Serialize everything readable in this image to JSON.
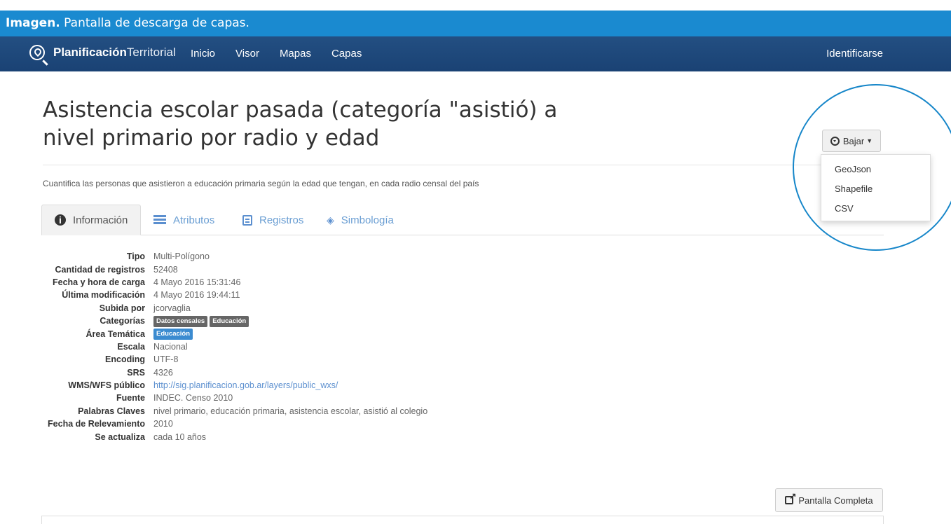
{
  "caption": {
    "bold": "Imagen.",
    "text": " Pantalla de descarga de capas."
  },
  "navbar": {
    "brand_bold": "Planificación",
    "brand_light": "Territorial",
    "links": [
      "Inicio",
      "Visor",
      "Mapas",
      "Capas"
    ],
    "login": "Identificarse"
  },
  "page": {
    "title": "Asistencia escolar pasada (categoría \"asistió) a nivel primario por radio y edad",
    "description": "Cuantifica las personas que asistieron a educación primaria según la edad que tengan, en cada radio censal del país"
  },
  "tabs": [
    "Información",
    "Atributos",
    "Registros",
    "Simbología"
  ],
  "info": {
    "tipo_label": "Tipo",
    "tipo": "Multi-Polígono",
    "registros_label": "Cantidad de registros",
    "registros": "52408",
    "carga_label": "Fecha y hora de carga",
    "carga": "4 Mayo 2016 15:31:46",
    "modificacion_label": "Última modificación",
    "modificacion": "4 Mayo 2016 19:44:11",
    "subida_label": "Subida por",
    "subida": "jcorvaglia",
    "categorias_label": "Categorías",
    "categorias": [
      "Datos censales",
      "Educación"
    ],
    "area_label": "Área Temática",
    "area": "Educación",
    "escala_label": "Escala",
    "escala": "Nacional",
    "encoding_label": "Encoding",
    "encoding": "UTF-8",
    "srs_label": "SRS",
    "srs": "4326",
    "wms_label": "WMS/WFS público",
    "wms": "http://sig.planificacion.gob.ar/layers/public_wxs/",
    "fuente_label": "Fuente",
    "fuente": "INDEC. Censo 2010",
    "claves_label": "Palabras Claves",
    "claves": "nivel primario, educación primaria, asistencia escolar, asistió al colegio",
    "relevamiento_label": "Fecha de Relevamiento",
    "relevamiento": "2010",
    "actualiza_label": "Se actualiza",
    "actualiza": "cada 10 años"
  },
  "download": {
    "label": "Bajar",
    "options": [
      "GeoJson",
      "Shapefile",
      "CSV"
    ]
  },
  "fullscreen_label": "Pantalla Completa",
  "colors": {
    "caption": "#1a8ad0",
    "navbar": "#1f4a7d",
    "link": "#5b8fcf",
    "highlight": "#1686c9"
  }
}
